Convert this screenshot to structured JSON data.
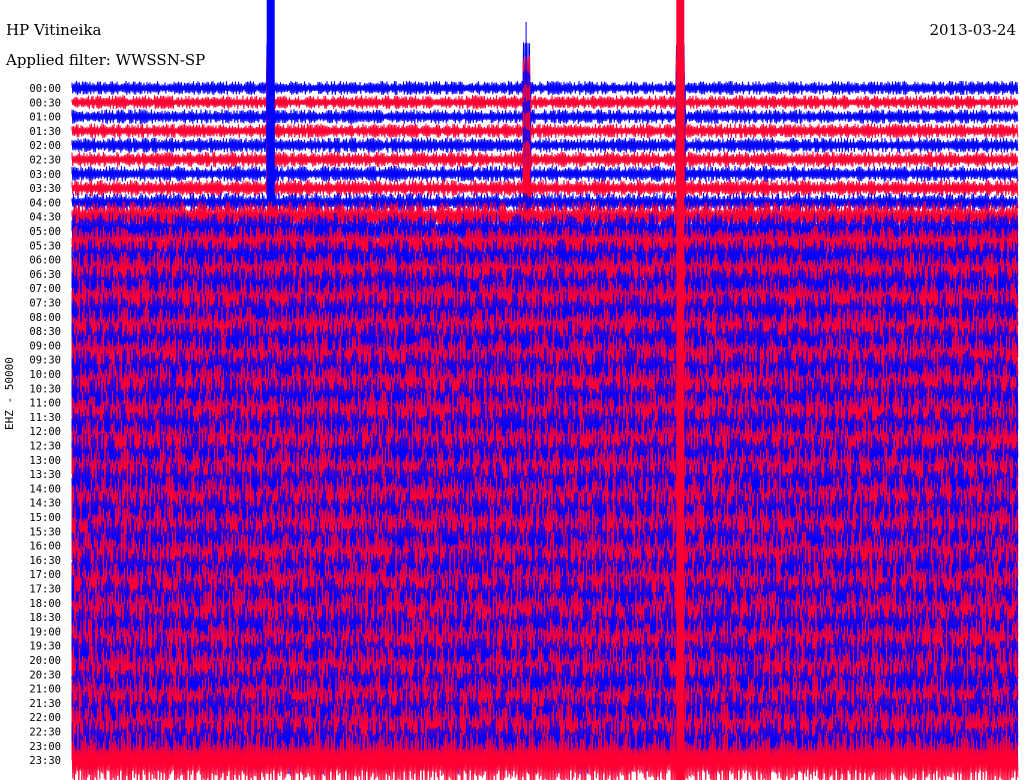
{
  "header": {
    "station": "HP Vitineika",
    "date": "2013-03-24",
    "filter": "Applied filter: WWSSN-SP"
  },
  "channel_label": "EHZ - 50000",
  "colors": {
    "trace_a": "#0000ff",
    "trace_b": "#ff0033",
    "text": "#000000"
  },
  "chart_data": {
    "type": "line",
    "title": "HP Vitineika",
    "subtitle": "Applied filter: WWSSN-SP",
    "ylabel": "EHZ - 50000",
    "row_labels": [
      "00:00",
      "00:30",
      "01:00",
      "01:30",
      "02:00",
      "02:30",
      "03:00",
      "03:30",
      "04:00",
      "04:30",
      "05:00",
      "05:30",
      "06:00",
      "06:30",
      "07:00",
      "07:30",
      "08:00",
      "08:30",
      "09:00",
      "09:30",
      "10:00",
      "10:30",
      "11:00",
      "11:30",
      "12:00",
      "12:30",
      "13:00",
      "13:30",
      "14:00",
      "14:30",
      "15:00",
      "15:30",
      "16:00",
      "16:30",
      "17:00",
      "17:30",
      "18:00",
      "18:30",
      "19:00",
      "19:30",
      "20:00",
      "20:30",
      "21:00",
      "21:30",
      "22:00",
      "22:30",
      "23:00",
      "23:30"
    ],
    "row_minutes": 30,
    "series_colors_alternating": [
      "#0000ff",
      "#ff0033"
    ],
    "noise_level_by_row": [
      0.12,
      0.12,
      0.13,
      0.13,
      0.14,
      0.15,
      0.16,
      0.17,
      0.22,
      0.45,
      0.55,
      0.6,
      0.65,
      0.7,
      0.75,
      0.78,
      0.8,
      0.8,
      0.82,
      0.82,
      0.85,
      0.85,
      0.88,
      0.88,
      0.9,
      0.9,
      0.9,
      0.92,
      0.92,
      0.92,
      0.95,
      0.95,
      0.95,
      0.95,
      0.95,
      0.95,
      0.95,
      0.95,
      0.95,
      0.95,
      0.95,
      0.95,
      0.95,
      0.95,
      0.95,
      0.95,
      0.95,
      0.95
    ],
    "events": [
      {
        "label": "large transient",
        "time": "00:00-03:30",
        "x_fraction": 0.21
      },
      {
        "label": "large transient",
        "time": "00:00-23:30",
        "x_fraction": 0.643
      },
      {
        "label": "spike",
        "time": "00:00",
        "x_fraction": 0.48
      }
    ]
  }
}
